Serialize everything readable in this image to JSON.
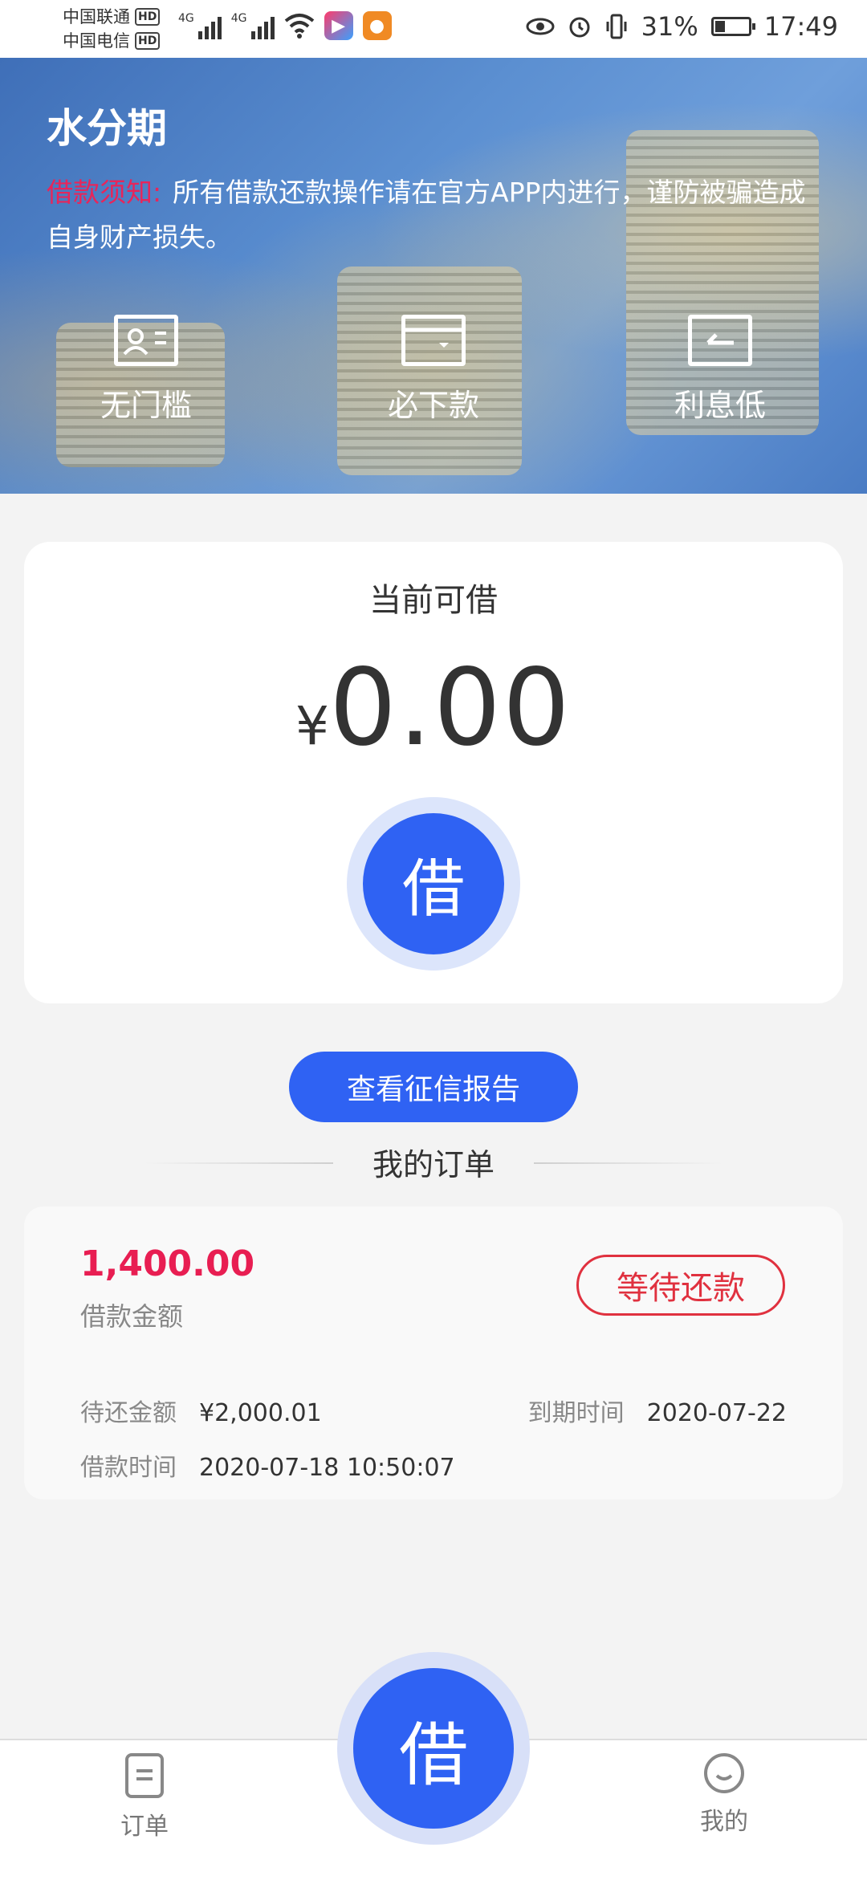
{
  "status_bar": {
    "carrier1": "中国联通",
    "carrier2": "中国电信",
    "hd": "HD",
    "net": "4G",
    "battery_text": "31%",
    "battery_level": 0.31,
    "time": "17:49"
  },
  "banner": {
    "title": "水分期",
    "notice_label": "借款须知:",
    "notice_text": "所有借款还款操作请在官方APP内进行，谨防被骗造成自身财产损失。",
    "features": [
      "无门槛",
      "必下款",
      "利息低"
    ]
  },
  "card": {
    "title": "当前可借",
    "currency": "¥",
    "amount": "0.00",
    "borrow_label": "借"
  },
  "credit_button": "查看征信报告",
  "orders": {
    "heading": "我的订单",
    "items": [
      {
        "amount": "1,400.00",
        "amount_label": "借款金额",
        "status": "等待还款",
        "repay_label": "待还金额",
        "repay_value": "¥2,000.01",
        "due_label": "到期时间",
        "due_value": "2020-07-22",
        "time_label": "借款时间",
        "time_value": "2020-07-18 10:50:07"
      }
    ]
  },
  "bottom_nav": {
    "orders_label": "订单",
    "fab_label": "借",
    "me_label": "我的"
  },
  "colors": {
    "primary": "#2f62f3",
    "accent_red": "#e81e52",
    "notice_red": "#e8255a"
  }
}
